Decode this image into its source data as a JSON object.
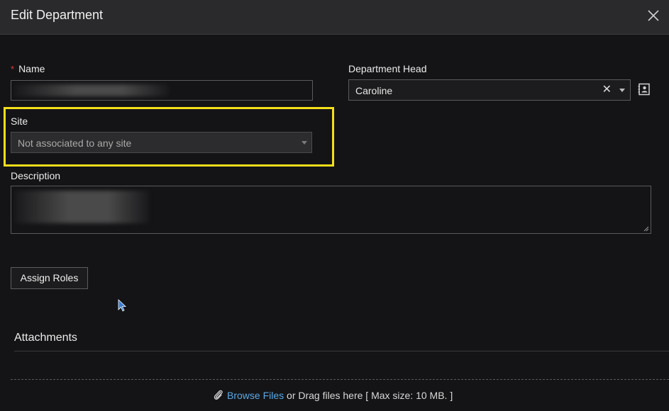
{
  "dialog": {
    "title": "Edit Department"
  },
  "form": {
    "name": {
      "label": "Name",
      "required_marker": "*"
    },
    "department_head": {
      "label": "Department Head",
      "value": "Caroline"
    },
    "site": {
      "label": "Site",
      "value": "Not associated to any site"
    },
    "description": {
      "label": "Description"
    },
    "assign_roles_label": "Assign Roles"
  },
  "attachments": {
    "title": "Attachments",
    "browse_label": "Browse Files",
    "drag_text": " or Drag files here [ Max size: 10 MB. ]"
  },
  "colors": {
    "highlight": "#f4df1a",
    "link": "#5aa9e6",
    "required": "#e03a3a"
  },
  "icons": {
    "close": "close-icon",
    "caret": "chevron-down-icon",
    "clear": "clear-icon",
    "contact": "contact-card-icon",
    "attachment": "paperclip-icon"
  }
}
